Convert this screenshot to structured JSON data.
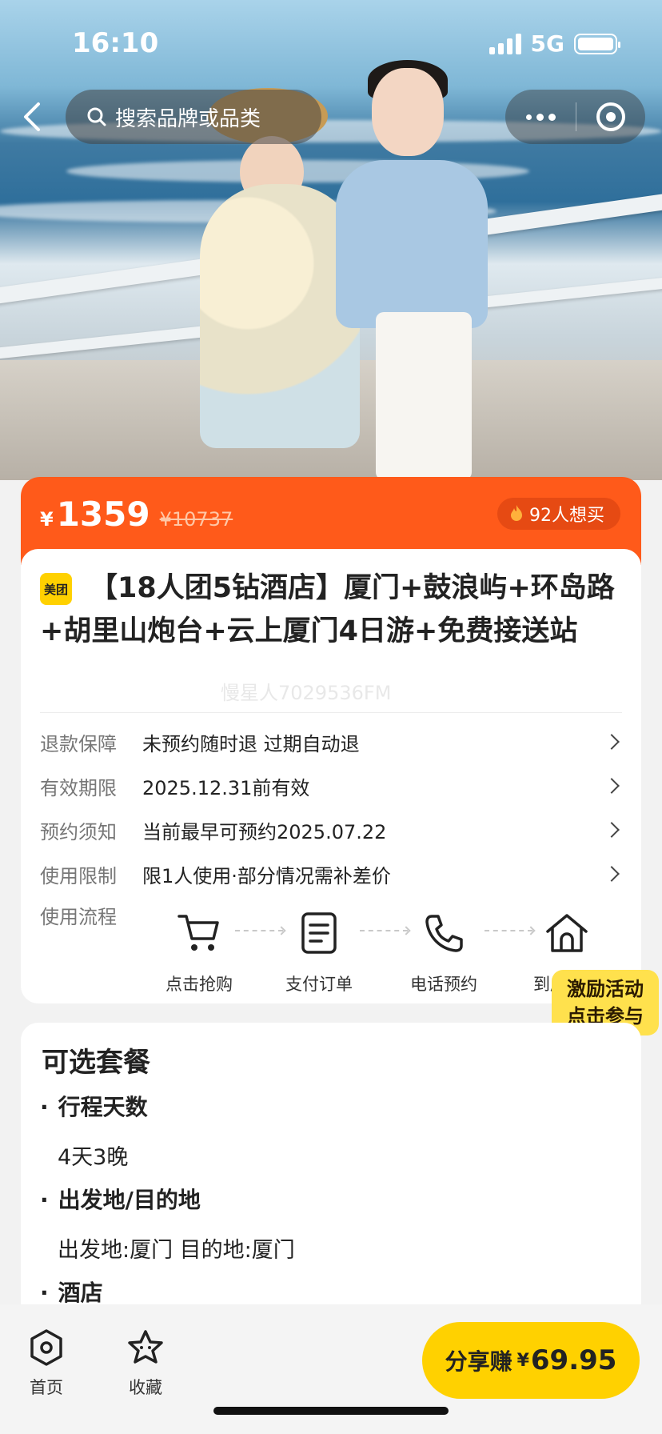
{
  "status_bar": {
    "time": "16:10",
    "network": "5G"
  },
  "search": {
    "placeholder": "搜索品牌或品类"
  },
  "price": {
    "currency": "¥",
    "current": "1359",
    "original": "¥10737",
    "want_count": "92人想买"
  },
  "product": {
    "badge": "美团",
    "title": "【18人团5钻酒店】厦门+鼓浪屿+环岛路+胡里山炮台+云上厦门4日游+免费接送站",
    "watermark": "慢星人7029536FM"
  },
  "info_rows": [
    {
      "key": "退款保障",
      "value": "未预约随时退 过期自动退"
    },
    {
      "key": "有效期限",
      "value": "2025.12.31前有效"
    },
    {
      "key": "预约须知",
      "value": "当前最早可预约2025.07.22"
    },
    {
      "key": "使用限制",
      "value": "限1人使用·部分情况需补差价"
    }
  ],
  "flow": {
    "label": "使用流程",
    "steps": [
      {
        "label": "点击抢购",
        "icon": "cart-icon"
      },
      {
        "label": "支付订单",
        "icon": "document-icon"
      },
      {
        "label": "电话预约",
        "icon": "phone-icon"
      },
      {
        "label": "到店使用",
        "icon": "home-icon"
      }
    ]
  },
  "promo": {
    "line1": "激励活动",
    "line2": "点击参与"
  },
  "packages": {
    "title": "可选套餐",
    "sections": [
      {
        "heading": "行程天数",
        "value": "4天3晚"
      },
      {
        "heading": "出发地/目的地",
        "value": "出发地:厦门 目的地:厦门"
      },
      {
        "heading": "酒店",
        "value": ""
      }
    ]
  },
  "bottom_bar": {
    "home": "首页",
    "favorite": "收藏",
    "share_label": "分享赚",
    "share_currency": "¥",
    "share_amount": "69.95"
  },
  "colors": {
    "accent_orange": "#ff5a1a",
    "brand_yellow": "#ffd100"
  }
}
